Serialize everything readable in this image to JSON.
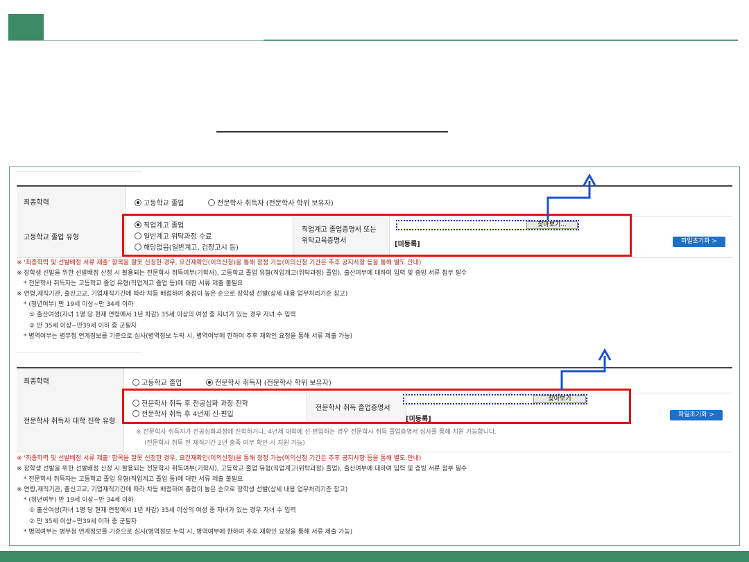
{
  "colors": {
    "accent": "#3d8a67",
    "highlight_box": "#e11414",
    "arrow": "#1a4fd6",
    "button": "#1f6fc7"
  },
  "section1": {
    "final_edu_label": "최종학력",
    "final_edu_options": [
      "고등학교 졸업",
      "전문학사 취득자 (전문학사 학위 보유자)"
    ],
    "final_edu_selected": "고등학교 졸업",
    "hs_type_label": "고등학교 졸업 유형",
    "hs_type_options": [
      "직업계고 졸업",
      "일반계고 위탁과정 수료",
      "해당없음(일반계고, 검정고시 등)"
    ],
    "hs_type_selected": "직업계고 졸업",
    "cert_label_line1": "직업계고 졸업증명서 또는",
    "cert_label_line2": "위탁교육증명서",
    "find_button": "찾아보기...",
    "unregistered": "[미등록]",
    "reset_button": "파일초기화 >"
  },
  "notes1": {
    "red": "※ '최종학력 및 선발배정 서류 제출' 항목을 잘못 신청한 경우, 요건재확인(이의신청)을 통해 정정 가능(이의신청 기간은 추후 공지사항 등을 통해 별도 안내)",
    "lines": [
      "※ 장학생 선발을 위한 선발배정 산정 시 활용되는 전문학사 취득여부(기학사), 고등학교 졸업 유형(직업계고(위탁과정) 졸업), 출산여부에 대하여 입력 및 증빙 서류 첨부 필수",
      "* 전문학사 취득자는 고등학교 졸업 유형(직업계고 졸업 등)에 대한 서류 제출 불필요",
      "※ 연령,재직기관, 출신고교, 기업재직기간에 따라 차등 배점하여 총점이 높은 순으로 장학생 선발(상세 내용 업무처리기준 참고)",
      "* (청년여부) 만 19세 이상~만 34세 이하",
      "① 출산여성(자녀 1명 당 현재 연령에서 1년 차감) 35세 이상의 여성 중 자녀가 있는 경우 자녀 수 입력",
      "② 만 35세 이상~만39세 이하 중 군필자",
      "* 병역여부는 병무청 연계정보를 기준으로 심사(병역정보 누락 시, 병역여부에 한하여 추후 재확인 요청을 통해 서류 제출 가능)"
    ]
  },
  "section2": {
    "final_edu_label": "최종학력",
    "final_edu_options": [
      "고등학교 졸업",
      "전문학사 취득자 (전문학사 학위 보유자)"
    ],
    "final_edu_selected": "전문학사 취득자 (전문학사 학위 보유자)",
    "univ_type_label": "전문학사 취득자 대학 진학 유형",
    "univ_type_options": [
      "전문학사 취득 후 전공심화 과정 진학",
      "전문학사 취득 후 4년제 신·편입"
    ],
    "cert_label": "전문학사 취득 졸업증명서",
    "find_button": "찾아보기",
    "unregistered": "[미등록]",
    "reset_button": "파일초기화 >",
    "info_line1": "※ 전문학사 취득자가 전공심화과정에 진학하거나, 4년제 대학에 신·편입하는 경우 전문학사 취득 졸업증명서 심사를 통해 지원 가능합니다.",
    "info_line2": "(전문학사 취득 전 재직기간 2년 충족 여부 확인 시 지원 가능)"
  },
  "notes2": {
    "red": "※ '최종학력 및 선발배정 서류 제출' 항목을 잘못 신청한 경우, 요건재확인(이의신청)을 통해 정정 가능(이의신청 기간은 추후 공지사항 등을 통해 별도 안내)",
    "lines": [
      "※ 장학생 선발을 위한 선발배정 산정 시 활용되는 전문학사 취득여부(기학사), 고등학교 졸업 유형(직업계고(위탁과정) 졸업), 출산여부에 대하여 입력 및 증빙 서류 첨부 필수",
      "* 전문학사 취득자는 고등학교 졸업 유형(직업계고 졸업 등)에 대한 서류 제출 불필요",
      "※ 연령,재직기관, 출신고교, 기업재직기간에 따라 차등 배점하여 총점이 높은 순으로 장학생 선발(상세 내용 업무처리기준 참고)",
      "* (청년여부) 만 19세 이상~만 34세 이하",
      "① 출산여성(자녀 1명 당 현재 연령에서 1년 차감) 35세 이상의 여성 중 자녀가 있는 경우 자녀 수 입력",
      "② 만 35세 이상~만39세 이하 중 군필자",
      "* 병역여부는 병무청 연계정보를 기준으로 심사(병역정보 누락 시, 병역여부에 한하여 추후 재확인 요청을 통해 서류 제출 가능)"
    ]
  }
}
